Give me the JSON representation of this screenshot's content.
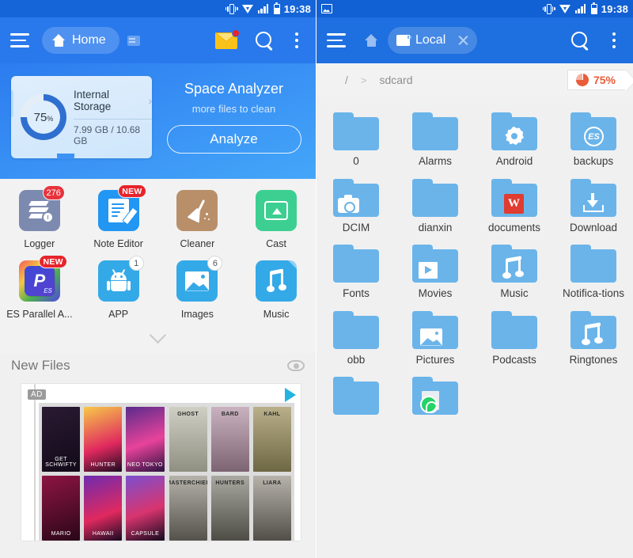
{
  "left": {
    "statusbar": {
      "time": "19:38",
      "icons": [
        "vibrate-icon",
        "wifi-icon",
        "signal-icon",
        "battery-icon"
      ]
    },
    "appbar": {
      "menu": "menu-icon",
      "home_label": "Home",
      "tab_icon": "window-icon",
      "mail_icon": "mail-icon",
      "search_icon": "search-icon",
      "overflow_icon": "more-vertical-icon"
    },
    "hero": {
      "storage_percent": "75",
      "percent_symbol": "%",
      "storage_title": "Internal Storage",
      "storage_usage": "7.99 GB / 10.68 GB",
      "analyzer_title": "Space Analyzer",
      "analyzer_sub": "more files to clean",
      "analyze_button": "Analyze"
    },
    "apps": [
      {
        "label": "Logger",
        "badge": "276",
        "badge_type": "count",
        "icon": "logger-icon"
      },
      {
        "label": "Note Editor",
        "badge": "NEW",
        "badge_type": "new",
        "icon": "note-editor-icon"
      },
      {
        "label": "Cleaner",
        "badge": "",
        "badge_type": "none",
        "icon": "broom-icon"
      },
      {
        "label": "Cast",
        "badge": "",
        "badge_type": "none",
        "icon": "cast-icon"
      },
      {
        "label": "ES Parallel A...",
        "badge": "NEW",
        "badge_type": "new",
        "icon": "parallel-app-icon"
      },
      {
        "label": "APP",
        "badge": "1",
        "badge_type": "light",
        "icon": "android-icon"
      },
      {
        "label": "Images",
        "badge": "6",
        "badge_type": "light",
        "icon": "image-icon"
      },
      {
        "label": "Music",
        "badge": "",
        "badge_type": "none",
        "icon": "music-note-icon"
      }
    ],
    "expand_icon": "chevron-down-icon",
    "new_files": {
      "title": "New Files",
      "eye_icon": "eye-icon",
      "ad_label": "AD",
      "ad_play_icon": "ad-choices-icon",
      "ad_tiles_left": [
        "GET SCHWIFTY",
        "HUNTER",
        "NEO TOKYO",
        "MARIO",
        "HAWAII",
        "CAPSULE"
      ],
      "ad_tiles_right": [
        "GHOST",
        "BARD",
        "KAHL",
        "MASTERCHIEF",
        "HUNTERS",
        "LIARA"
      ]
    }
  },
  "right": {
    "statusbar": {
      "time": "19:38",
      "photo_icon": "photo-icon"
    },
    "appbar": {
      "menu": "menu-icon",
      "home_icon": "home-icon",
      "tab_label": "Local",
      "tab_icon": "sdcard-icon",
      "tab_close_icon": "close-icon",
      "search_icon": "search-icon",
      "overflow_icon": "more-vertical-icon"
    },
    "breadcrumb": {
      "root": "/",
      "separator": ">",
      "current": "sdcard"
    },
    "usage_badge": {
      "percent": "75%",
      "icon": "pie-chart-icon"
    },
    "folders": [
      {
        "label": "0",
        "overlay": "none"
      },
      {
        "label": "Alarms",
        "overlay": "none"
      },
      {
        "label": "Android",
        "overlay": "gear"
      },
      {
        "label": "backups",
        "overlay": "es"
      },
      {
        "label": "DCIM",
        "overlay": "camera"
      },
      {
        "label": "dianxin",
        "overlay": "none"
      },
      {
        "label": "documents",
        "overlay": "wps"
      },
      {
        "label": "Download",
        "overlay": "download"
      },
      {
        "label": "Fonts",
        "overlay": "none"
      },
      {
        "label": "Movies",
        "overlay": "play"
      },
      {
        "label": "Music",
        "overlay": "note"
      },
      {
        "label": "Notifica-tions",
        "overlay": "none"
      },
      {
        "label": "obb",
        "overlay": "none"
      },
      {
        "label": "Pictures",
        "overlay": "picture"
      },
      {
        "label": "Podcasts",
        "overlay": "none"
      },
      {
        "label": "Ringtones",
        "overlay": "note"
      },
      {
        "label": "",
        "overlay": "none"
      },
      {
        "label": "",
        "overlay": "whatsapp"
      }
    ],
    "wps_letter": "W",
    "es_letter": "ES"
  },
  "colors": {
    "appbar_blue": "#2979ed",
    "status_blue": "#1565d8",
    "folder_blue": "#6ab4ea",
    "accent_red": "#e8333c",
    "usage_orange": "#ea5c3a"
  }
}
